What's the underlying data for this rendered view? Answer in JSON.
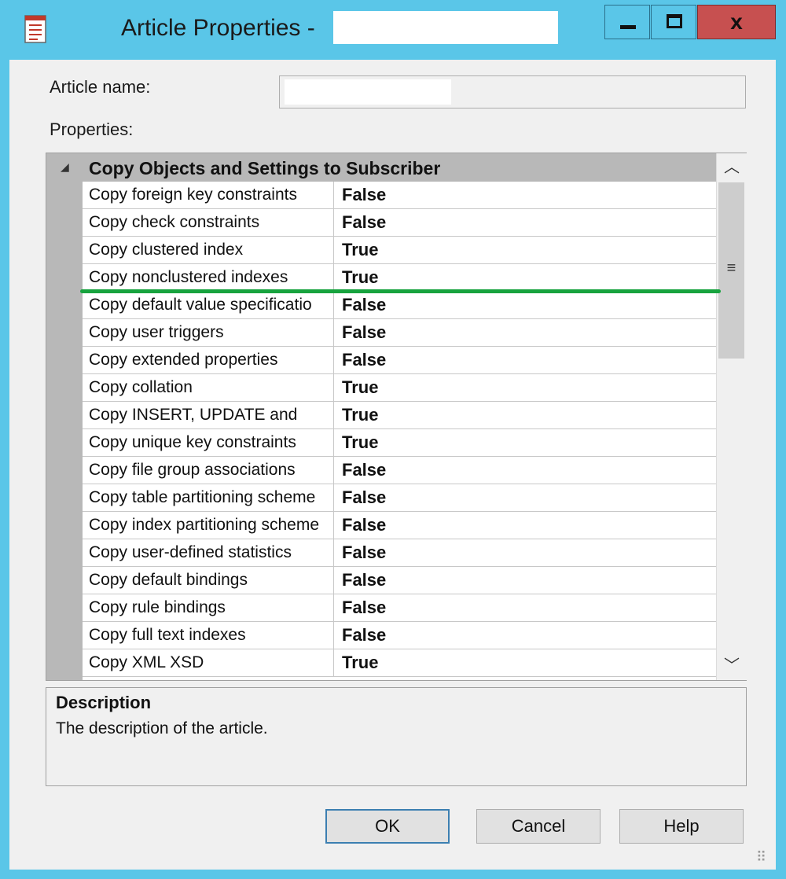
{
  "window": {
    "title": "Article Properties -",
    "controls": {
      "minimize": "minimize",
      "maximize": "maximize",
      "close": "x"
    }
  },
  "article_name": {
    "label": "Article name:",
    "value": ""
  },
  "properties": {
    "label": "Properties:",
    "category": "Copy Objects and Settings to Subscriber",
    "rows": [
      {
        "name": "Copy foreign key constraints",
        "value": "False"
      },
      {
        "name": "Copy check constraints",
        "value": "False"
      },
      {
        "name": "Copy clustered index",
        "value": "True"
      },
      {
        "name": "Copy nonclustered indexes",
        "value": "True"
      },
      {
        "name": "Copy default value specificatio",
        "value": "False"
      },
      {
        "name": "Copy user triggers",
        "value": "False"
      },
      {
        "name": "Copy extended properties",
        "value": "False"
      },
      {
        "name": "Copy collation",
        "value": "True"
      },
      {
        "name": "Copy INSERT, UPDATE and",
        "value": "True"
      },
      {
        "name": "Copy unique key constraints",
        "value": "True"
      },
      {
        "name": "Copy file group associations",
        "value": "False"
      },
      {
        "name": "Copy table partitioning scheme",
        "value": "False"
      },
      {
        "name": "Copy index partitioning scheme",
        "value": "False"
      },
      {
        "name": "Copy user-defined statistics",
        "value": "False"
      },
      {
        "name": "Copy default bindings",
        "value": "False"
      },
      {
        "name": "Copy rule bindings",
        "value": "False"
      },
      {
        "name": "Copy full text indexes",
        "value": "False"
      },
      {
        "name": "Copy XML XSD",
        "value": "True"
      }
    ]
  },
  "description": {
    "title": "Description",
    "text": "The description of the article."
  },
  "buttons": {
    "ok": "OK",
    "cancel": "Cancel",
    "help": "Help"
  },
  "colors": {
    "titlebar": "#5ac6e8",
    "close_button": "#c75050",
    "annotation_line": "#17a33e",
    "category_band": "#b8b8b8"
  }
}
